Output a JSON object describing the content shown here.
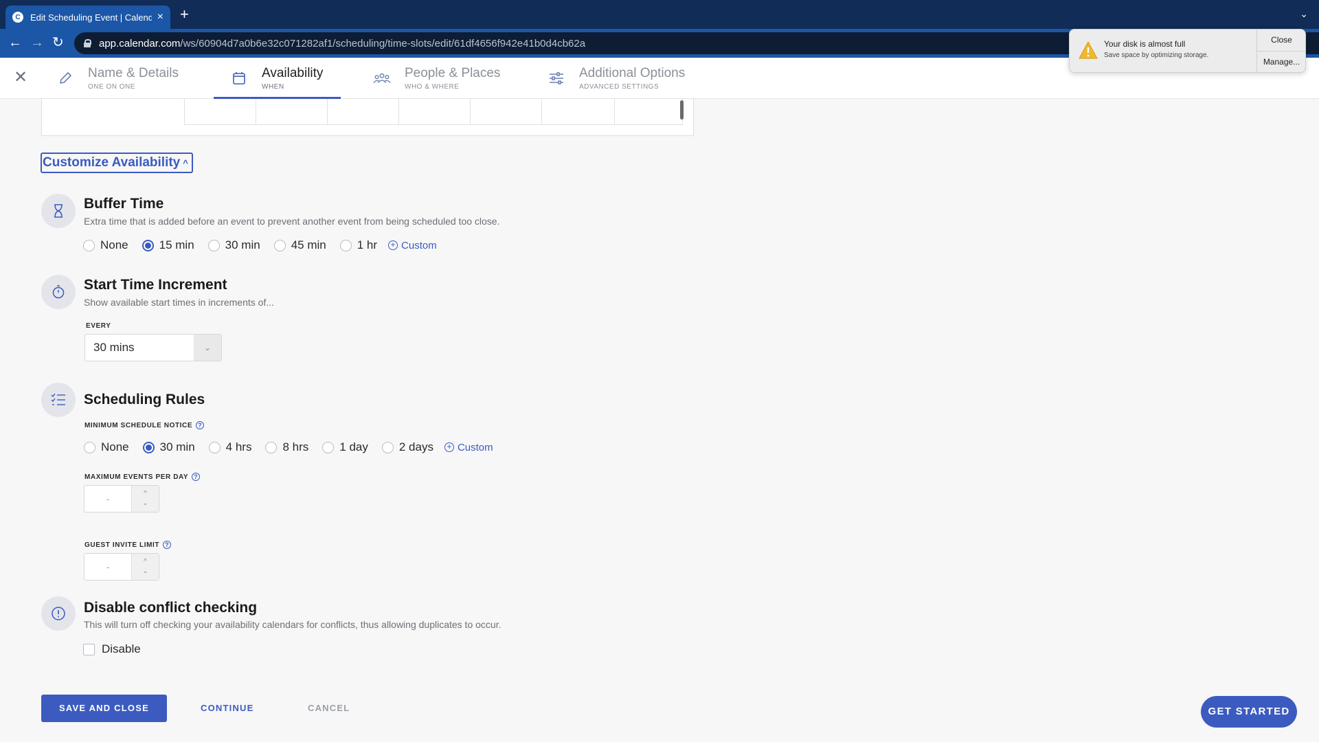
{
  "browser": {
    "tab_title": "Edit Scheduling Event | Calendar",
    "tab_favicon_letter": "C",
    "url_host": "app.calendar.com",
    "url_path": "/ws/60904d7a0b6e32c071282af1/scheduling/time-slots/edit/61df4656f942e41b0d4cb62a"
  },
  "notification": {
    "title": "Your disk is almost full",
    "subtitle": "Save space by optimizing storage.",
    "close_label": "Close",
    "manage_label": "Manage..."
  },
  "steps": [
    {
      "title": "Name & Details",
      "subtitle": "ONE ON ONE",
      "icon": "pencil-icon"
    },
    {
      "title": "Availability",
      "subtitle": "WHEN",
      "icon": "calendar-icon",
      "active": true
    },
    {
      "title": "People & Places",
      "subtitle": "WHO & WHERE",
      "icon": "people-icon"
    },
    {
      "title": "Additional Options",
      "subtitle": "ADVANCED SETTINGS",
      "icon": "sliders-icon"
    }
  ],
  "customize": {
    "label": "Customize Availability"
  },
  "buffer": {
    "title": "Buffer Time",
    "description": "Extra time that is added before an event to prevent another event from being scheduled too close.",
    "options": [
      "None",
      "15 min",
      "30 min",
      "45 min",
      "1 hr"
    ],
    "selected": "15 min",
    "custom_label": "Custom"
  },
  "increment": {
    "title": "Start Time Increment",
    "description": "Show available start times in increments of...",
    "every_label": "EVERY",
    "value": "30 mins"
  },
  "rules": {
    "title": "Scheduling Rules",
    "min_notice_label": "MINIMUM SCHEDULE NOTICE",
    "options": [
      "None",
      "30 min",
      "4 hrs",
      "8 hrs",
      "1 day",
      "2 days"
    ],
    "selected": "30 min",
    "custom_label": "Custom",
    "max_events_label": "MAXIMUM EVENTS PER DAY",
    "max_events_value": "-",
    "guest_limit_label": "GUEST INVITE LIMIT",
    "guest_limit_value": "-"
  },
  "conflict": {
    "title": "Disable conflict checking",
    "description": "This will turn off checking your availability calendars for conflicts, thus allowing duplicates to occur.",
    "checkbox_label": "Disable"
  },
  "footer": {
    "save_label": "SAVE AND CLOSE",
    "continue_label": "CONTINUE",
    "cancel_label": "CANCEL",
    "get_started_label": "GET STARTED"
  },
  "colors": {
    "accent": "#3b5bc0",
    "chrome": "#1c56a6"
  }
}
